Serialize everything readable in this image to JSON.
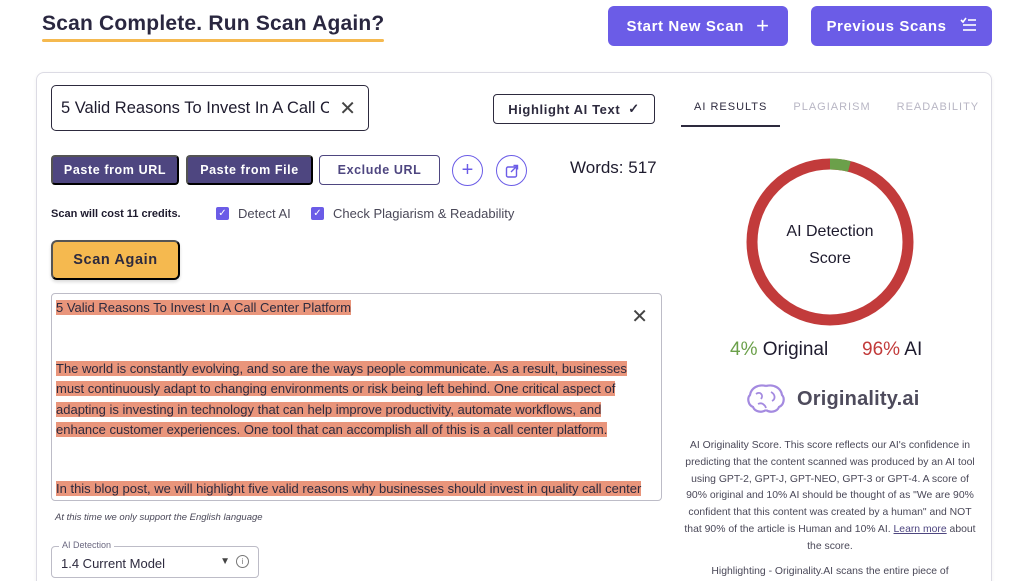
{
  "header": {
    "title": "Scan Complete. Run Scan Again?",
    "start_new_scan": "Start New Scan",
    "start_icon": "+",
    "previous_scans": "Previous Scans",
    "previous_icon": "≡"
  },
  "title_field": {
    "value": "5 Valid Reasons To Invest In A Call Center Platform"
  },
  "highlight_button": "Highlight AI Text",
  "tabs": [
    "AI RESULTS",
    "PLAGIARISM",
    "READABILITY"
  ],
  "toolbar": {
    "paste_url": "Paste from URL",
    "paste_file": "Paste from File",
    "exclude_url": "Exclude URL",
    "words_label": "Words: 517"
  },
  "scan_options": {
    "cost_text": "Scan will cost 11 credits.",
    "detect_ai": "Detect AI",
    "plagiarism_readability": "Check Plagiarism & Readability",
    "scan_again": "Scan Again"
  },
  "editor": {
    "p1": "5 Valid Reasons To Invest In A Call Center Platform",
    "p2": "The world is constantly evolving, and so are the ways people communicate. As a result, businesses must continuously adapt to changing environments or risk being left behind. One critical aspect of adapting is investing in technology that can help improve productivity, automate workflows, and enhance customer experiences. One tool that can accomplish all of this is a call center platform.",
    "p3": "In this blog post, we will highlight five valid reasons why businesses should invest in quality call center"
  },
  "language_note": "At this time we only support the English language",
  "model_select": {
    "label": "AI Detection",
    "value": "1.4 Current Model"
  },
  "results": {
    "gauge_label_line1": "AI Detection",
    "gauge_label_line2": "Score",
    "original_pct": "4%",
    "original_label": "Original",
    "ai_pct": "96%",
    "ai_label": "AI",
    "brand": "Originality.ai",
    "score_description": "AI Originality Score. This score reflects our AI's confidence in predicting that the content scanned was produced by an AI tool using GPT-2, GPT-J, GPT-NEO, GPT-3 or GPT-4. A score of 90% original and 10% AI should be thought of as \"We are 90% confident that this content was created by a human\" and NOT that 90% of the article is Human and 10% AI.",
    "learn_more": "Learn more",
    "score_description_tail": "about the score.",
    "highlighting_text": "Highlighting - Originality.AI scans the entire piece of"
  },
  "colors": {
    "accent": "#6b5ce7",
    "dark_purple": "#4e4680",
    "scan_button": "#f5b94f",
    "original_green": "#6ba04a",
    "ai_red": "#c23b3b"
  },
  "score": {
    "original_fraction": 0.04,
    "ai_fraction": 0.96
  }
}
